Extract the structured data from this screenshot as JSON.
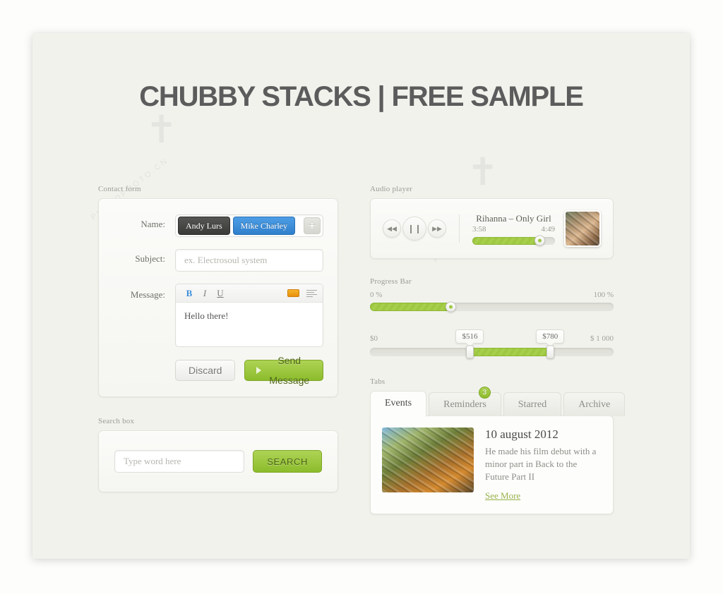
{
  "page": {
    "title": "CHUBBY STACKS | FREE SAMPLE",
    "accent_green": "#9EC841",
    "accent_blue": "#3C8DDE",
    "panel_bg": "#F2F2ED",
    "page_bg": "#FDFDFB",
    "watermark": "PHOTOPHOTO.CN"
  },
  "contact": {
    "section_label": "Contact form",
    "name_label": "Name:",
    "tags": [
      {
        "text": "Andy Lurs",
        "style": "dark"
      },
      {
        "text": "Mike Charley",
        "style": "blue"
      }
    ],
    "add_tag_label": "+",
    "subject_label": "Subject:",
    "subject_value": "",
    "subject_placeholder": "ex. Electrosoul system",
    "message_label": "Message:",
    "message_value": "Hello there!",
    "toolbar": {
      "bold": "B",
      "italic": "I",
      "underline": "U",
      "color_swatch": "color-swatch-icon",
      "align": "align-lines-icon"
    },
    "discard_label": "Discard",
    "send_label": "Send Message"
  },
  "search": {
    "section_label": "Search box",
    "value": "",
    "placeholder": "Type word here",
    "button_label": "SEARCH"
  },
  "audio": {
    "section_label": "Audio player",
    "track_title": "Rihanna – Only Girl",
    "elapsed": "3:58",
    "duration": "4:49",
    "progress_percent": 81,
    "controls": {
      "rewind": "⏪",
      "pause": "❙❙",
      "forward": "⏩"
    }
  },
  "progress": {
    "section_label": "Progress Bar",
    "single": {
      "min_label": "0 %",
      "max_label": "100 %",
      "value_percent": 33
    },
    "range": {
      "min_label": "$0",
      "max_label": "$ 1 000",
      "low_tip": "$516",
      "high_tip": "$780",
      "low_percent": 41,
      "high_percent": 74
    }
  },
  "tabs": {
    "section_label": "Tabs",
    "items": [
      {
        "label": "Events",
        "active": true,
        "badge": ""
      },
      {
        "label": "Reminders",
        "active": false,
        "badge": "3"
      },
      {
        "label": "Starred",
        "active": false,
        "badge": ""
      },
      {
        "label": "Archive",
        "active": false,
        "badge": ""
      }
    ],
    "content": {
      "title": "10 august 2012",
      "text": "He made his film debut with a minor part in Back to the Future Part II",
      "link": "See More"
    }
  }
}
